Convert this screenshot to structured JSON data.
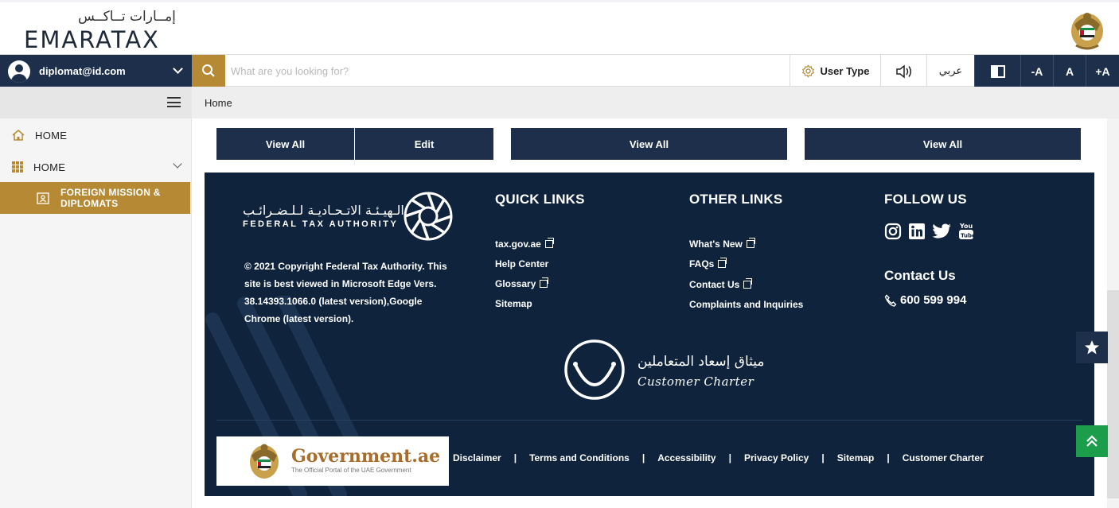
{
  "header": {
    "logo_ar": "إمــارات تــاكــس",
    "logo_en": "EMARATAX"
  },
  "navbar": {
    "user_email": "diplomat@id.com",
    "search_placeholder": "What are you looking for?",
    "user_type_label": "User Type",
    "language_label": "عربي",
    "font_decrease": "-A",
    "font_normal": "A",
    "font_increase": "+A"
  },
  "sidebar": {
    "items": [
      {
        "label": "HOME"
      },
      {
        "label": "HOME"
      }
    ],
    "active_item": "FOREIGN MISSION & DIPLOMATS"
  },
  "breadcrumb": {
    "current": "Home"
  },
  "cards": {
    "buttons": [
      "View All",
      "Edit",
      "View All",
      "View All"
    ]
  },
  "footer": {
    "fta_ar": "الـهيـئـة الاتـحـاديـة لـلـضـرائـب",
    "fta_en": "FEDERAL TAX AUTHORITY",
    "copyright": "© 2021 Copyright Federal Tax Authority. This site is best viewed in Microsoft Edge Vers. 38.14393.1066.0 (latest version),Google Chrome (latest version).",
    "quick_links_title": "QUICK LINKS",
    "quick_links": [
      "tax.gov.ae",
      "Help Center",
      "Glossary",
      "Sitemap"
    ],
    "other_links_title": "OTHER LINKS",
    "other_links": [
      "What's New",
      "FAQs",
      "Contact Us",
      "Complaints and Inquiries"
    ],
    "follow_title": "FOLLOW US",
    "social_icons": [
      "instagram-icon",
      "linkedin-icon",
      "twitter-icon",
      "youtube-icon"
    ],
    "contact_title": "Contact Us",
    "phone": "600 599 994",
    "charter_ar": "ميثاق إسعاد المتعاملين",
    "charter_en": "Customer Charter",
    "gov_title": "Government.ae",
    "gov_subtitle": "The Official Portal of the UAE Government",
    "legal_links": [
      "Disclaimer",
      "Terms and Conditions",
      "Accessibility",
      "Privacy Policy",
      "Sitemap",
      "Customer Charter"
    ]
  },
  "colors": {
    "navy": "#1d2f4a",
    "footer_bg": "#0f233d",
    "gold": "#b68a35",
    "green": "#1b9d4c"
  }
}
